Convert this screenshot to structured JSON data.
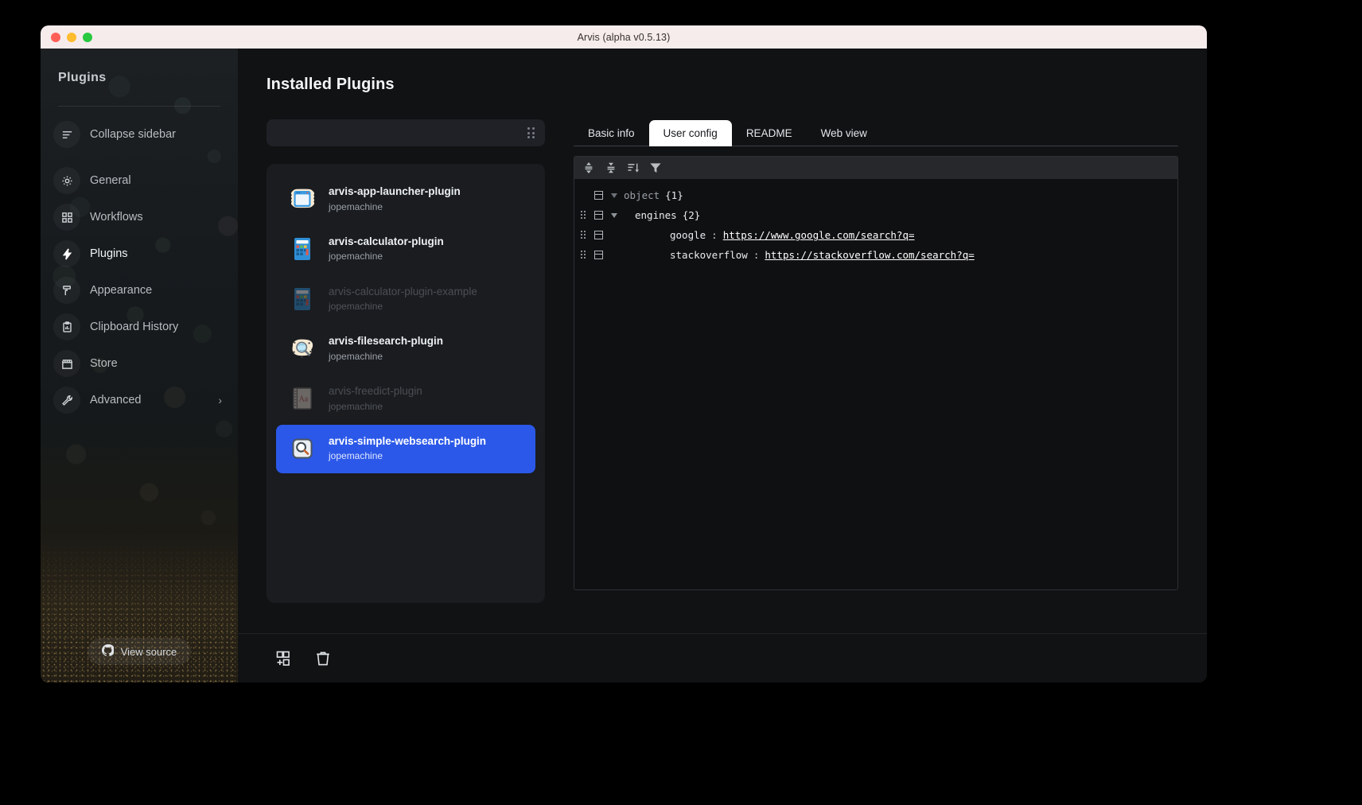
{
  "window": {
    "title": "Arvis (alpha v0.5.13)"
  },
  "sidebar": {
    "title": "Plugins",
    "collapse": {
      "label": "Collapse sidebar",
      "icon": "collapse-sidebar-icon"
    },
    "items": [
      {
        "label": "General",
        "icon": "gear-icon"
      },
      {
        "label": "Workflows",
        "icon": "workflows-grid-icon"
      },
      {
        "label": "Plugins",
        "icon": "lightning-bolt-icon"
      },
      {
        "label": "Appearance",
        "icon": "paint-roller-icon"
      },
      {
        "label": "Clipboard History",
        "icon": "clipboard-icon"
      },
      {
        "label": "Store",
        "icon": "storefront-icon"
      },
      {
        "label": "Advanced",
        "icon": "wrench-icon",
        "chevron": "›"
      }
    ],
    "view_source": {
      "label": "View source",
      "icon": "github-icon"
    }
  },
  "main": {
    "page_title": "Installed Plugins",
    "search": {
      "value": "",
      "placeholder": "",
      "grip_icon": "drag-handle-icon"
    },
    "plugins": [
      {
        "name": "arvis-app-launcher-plugin",
        "author": "jopemachine",
        "icon": "app-launcher-icon",
        "state": "enabled"
      },
      {
        "name": "arvis-calculator-plugin",
        "author": "jopemachine",
        "icon": "calculator-icon",
        "state": "enabled"
      },
      {
        "name": "arvis-calculator-plugin-example",
        "author": "jopemachine",
        "icon": "calculator-icon",
        "state": "disabled"
      },
      {
        "name": "arvis-filesearch-plugin",
        "author": "jopemachine",
        "icon": "file-search-icon",
        "state": "enabled"
      },
      {
        "name": "arvis-freedict-plugin",
        "author": "jopemachine",
        "icon": "dictionary-icon",
        "state": "disabled"
      },
      {
        "name": "arvis-simple-websearch-plugin",
        "author": "jopemachine",
        "icon": "web-search-icon",
        "state": "selected"
      }
    ],
    "tabs": [
      {
        "label": "Basic info",
        "active": false
      },
      {
        "label": "User config",
        "active": true
      },
      {
        "label": "README",
        "active": false
      },
      {
        "label": "Web view",
        "active": false
      }
    ],
    "json_toolbar": [
      {
        "icon": "expand-all-icon"
      },
      {
        "icon": "collapse-all-icon"
      },
      {
        "icon": "sort-icon"
      },
      {
        "icon": "filter-icon"
      }
    ],
    "json_tree": [
      {
        "key": "object",
        "count": "{1}",
        "indent": 0,
        "muted": true,
        "caret": "dim",
        "grip": false
      },
      {
        "key": "engines",
        "count": "{2}",
        "indent": 1,
        "muted": false,
        "caret": "normal",
        "grip": true
      },
      {
        "key": "google",
        "value": "https://www.google.com/search?q=",
        "indent": 2,
        "muted": false,
        "caret": "none",
        "grip": true
      },
      {
        "key": "stackoverflow",
        "value": "https://stackoverflow.com/search?q=",
        "indent": 2,
        "muted": false,
        "caret": "none",
        "grip": true
      }
    ],
    "bottom_toolbar": [
      {
        "icon": "add-plugin-icon"
      },
      {
        "icon": "trash-icon"
      }
    ]
  },
  "colors": {
    "accent": "#2b58e8",
    "sidebar_bg": "#181b1d",
    "main_bg": "#111214",
    "panel_bg": "#1a1c20"
  }
}
